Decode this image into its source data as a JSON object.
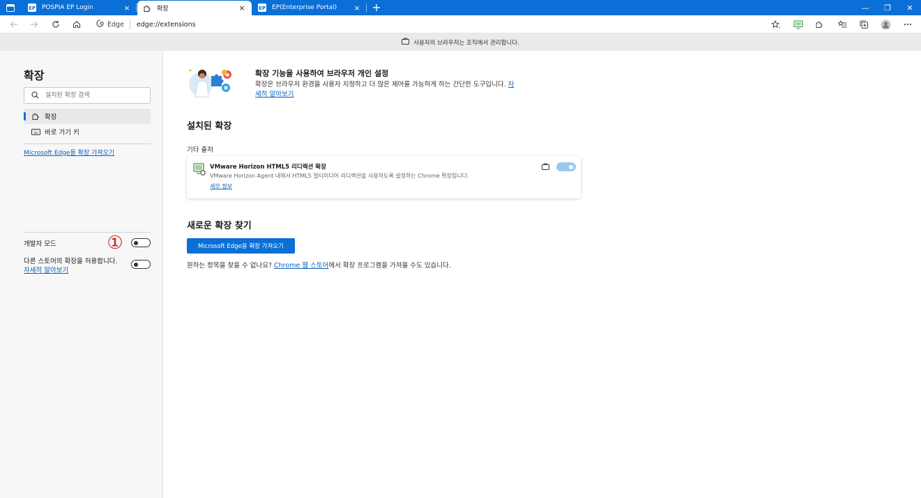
{
  "tabs": [
    {
      "title": "POSPIA EP Login",
      "active": false,
      "favicon": "ep-icon"
    },
    {
      "title": "확장",
      "active": true,
      "favicon": "puzzle-icon"
    },
    {
      "title": "EP(Enterprise Portal)",
      "active": false,
      "favicon": "ep-icon"
    }
  ],
  "tab_close_glyph": "×",
  "new_tab_glyph": "+",
  "window_controls": {
    "minimize": "—",
    "restore": "❐",
    "close": "✕"
  },
  "address_bar": {
    "site_label": "Edge",
    "url": "edge://extensions"
  },
  "managed_banner": "사용자의 브라우저는 조직에서 관리합니다.",
  "sidebar": {
    "title": "확장",
    "search_placeholder": "설치된 확장 검색",
    "nav": [
      {
        "label": "확장",
        "icon": "puzzle-icon",
        "selected": true
      },
      {
        "label": "바로 가기 키",
        "icon": "keyboard-icon",
        "selected": false
      }
    ],
    "store_link": "Microsoft Edge용 확장 가져오기",
    "developer_mode": {
      "label": "개발자 모드",
      "on": false
    },
    "other_stores": {
      "label": "다른 스토어의 확장을 허용합니다.",
      "link": "자세히 알아보기",
      "on": false
    },
    "annotation_marker": "①"
  },
  "main": {
    "hero": {
      "title": "확장 기능을 사용하여 브라우저 개인 설정",
      "desc": "확장은 브라우저 환경을 사용자 지정하고 더 많은 제어를 가능하게 하는 간단한 도구입니다. ",
      "link": "자세히 알아보기"
    },
    "installed_heading": "설치된 확장",
    "other_sources": "기타 출처",
    "extension": {
      "name": "VMware Horizon HTML5 리디렉션 확장",
      "description": "VMware Horizon Agent 내에서 HTML5 멀티미디어 리디렉션을 사용하도록 설정하는 Chrome 확장입니다.",
      "details": "세부 정보",
      "enabled": true
    },
    "find_heading": "새로운 확장 찾기",
    "get_button": "Microsoft Edge용 확장 가져오기",
    "find_note_pre": "원하는 항목을 찾을 수 없나요? ",
    "find_note_link": "Chrome 웹 스토어",
    "find_note_post": "에서 확장 프로그램을 가져올 수도 있습니다."
  }
}
